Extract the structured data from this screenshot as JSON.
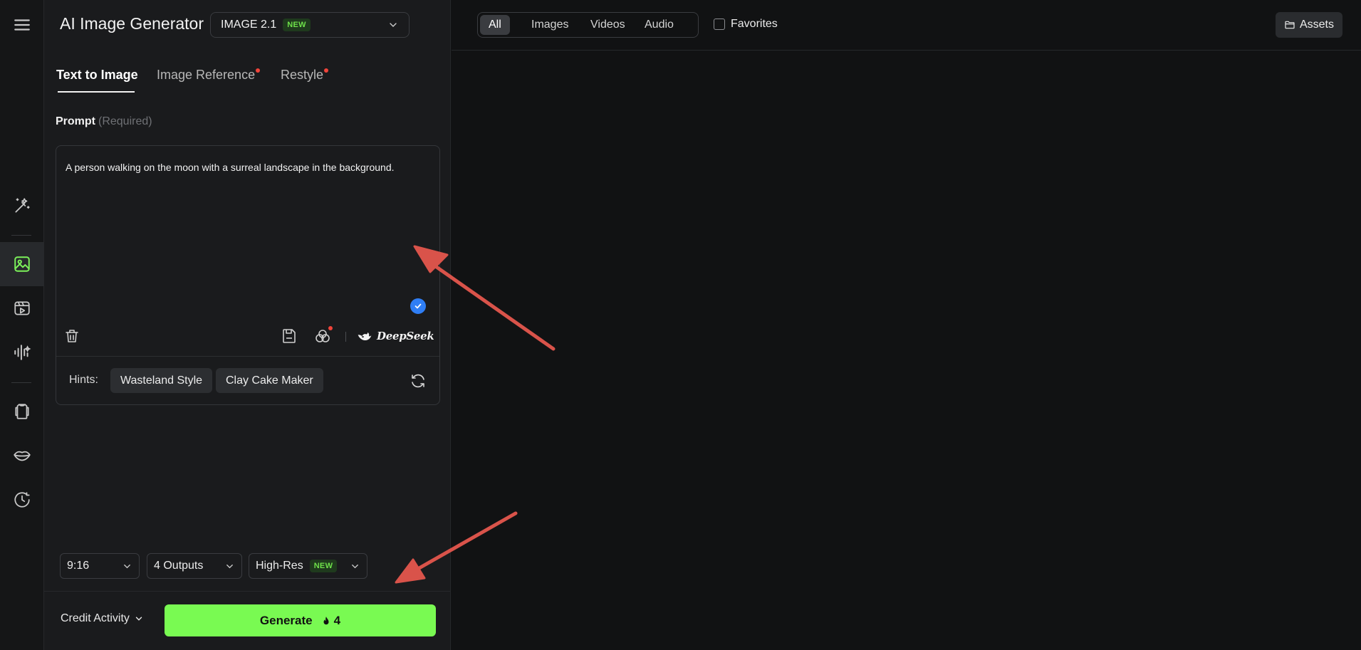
{
  "header": {
    "title": "AI Image Generator",
    "model_name": "IMAGE 2.1",
    "model_badge": "NEW"
  },
  "tabs": [
    {
      "label": "Text to Image",
      "active": true
    },
    {
      "label": "Image Reference",
      "dot": true
    },
    {
      "label": "Restyle",
      "dot": true
    }
  ],
  "prompt": {
    "label": "Prompt",
    "required": "(Required)",
    "value": "A person walking on the moon with a surreal landscape in the background.",
    "assistant": "DeepSeek"
  },
  "hints": {
    "label": "Hints:",
    "items": [
      "Wasteland Style",
      "Clay Cake Maker"
    ]
  },
  "options": {
    "aspect": "9:16",
    "outputs": "4 Outputs",
    "quality": "High-Res",
    "quality_badge": "NEW"
  },
  "footer": {
    "credit": "Credit Activity",
    "generate_label": "Generate",
    "generate_cost": "4"
  },
  "filters": [
    "All",
    "Images",
    "Videos",
    "Audio"
  ],
  "favorites_label": "Favorites",
  "assets_label": "Assets",
  "colors": {
    "accent": "#79fa52",
    "annotation": "#d9534a",
    "badge_blue": "#2f7ef5"
  },
  "icons": {
    "rail": [
      "menu-icon",
      "magic-wand-icon",
      "image-icon",
      "video-icon",
      "audio-wave-icon",
      "shirt-icon",
      "lips-icon",
      "history-icon"
    ]
  }
}
